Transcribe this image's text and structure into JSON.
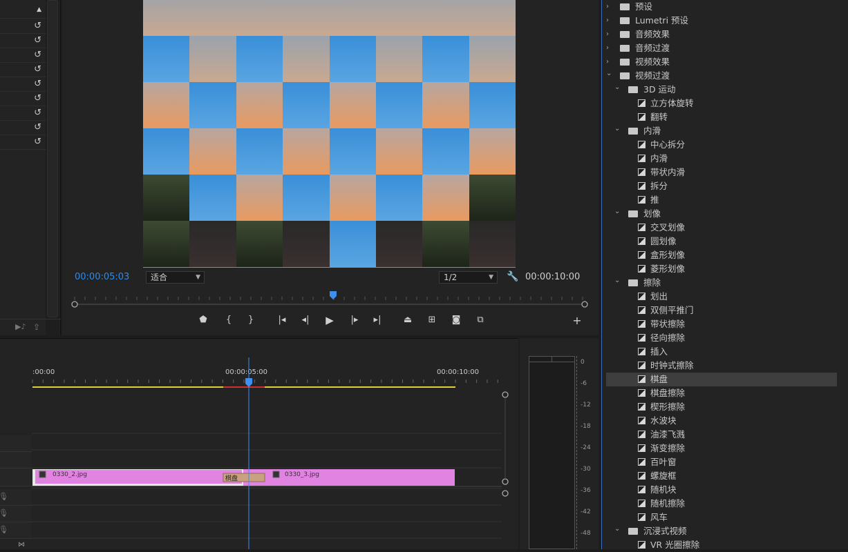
{
  "program": {
    "timecode_current": "00:00:05:03",
    "fit_select": "适合",
    "resolution_select": "1/2",
    "timecode_duration": "00:00:10:00"
  },
  "transport": {
    "marker": "add-marker-icon",
    "in": "mark-in-icon",
    "out": "mark-out-icon",
    "goto_in": "go-to-in-icon",
    "step_back": "step-back-icon",
    "play": "play-icon",
    "step_fwd": "step-forward-icon",
    "goto_out": "go-to-out-icon",
    "lift": "lift-icon",
    "extract": "extract-icon",
    "export_frame": "camera-icon",
    "compare": "comparison-view-icon",
    "add": "add-button-icon"
  },
  "timeline": {
    "ruler_labels": [
      ":00:00",
      "00:00:05:00",
      "00:00:10:00"
    ],
    "clip1": "0330_2.jpg",
    "transition": "棋盘",
    "clip2": "0330_3.jpg"
  },
  "meter": {
    "labels": [
      "0",
      "-6",
      "-12",
      "-18",
      "-24",
      "-30",
      "-36",
      "-42",
      "-48"
    ]
  },
  "effects": {
    "rows": [
      {
        "label": "预设",
        "level": 0,
        "kind": "folder-star",
        "open": false
      },
      {
        "label": "Lumetri 预设",
        "level": 0,
        "kind": "folder-star",
        "open": false
      },
      {
        "label": "音频效果",
        "level": 0,
        "kind": "folder",
        "open": false
      },
      {
        "label": "音频过渡",
        "level": 0,
        "kind": "folder",
        "open": false
      },
      {
        "label": "视频效果",
        "level": 0,
        "kind": "folder",
        "open": false
      },
      {
        "label": "视频过渡",
        "level": 0,
        "kind": "folder",
        "open": true
      },
      {
        "label": "3D 运动",
        "level": 1,
        "kind": "folder",
        "open": true
      },
      {
        "label": "立方体旋转",
        "level": 2,
        "kind": "fx"
      },
      {
        "label": "翻转",
        "level": 2,
        "kind": "fx"
      },
      {
        "label": "内滑",
        "level": 1,
        "kind": "folder",
        "open": true
      },
      {
        "label": "中心拆分",
        "level": 2,
        "kind": "fx"
      },
      {
        "label": "内滑",
        "level": 2,
        "kind": "fx"
      },
      {
        "label": "带状内滑",
        "level": 2,
        "kind": "fx"
      },
      {
        "label": "拆分",
        "level": 2,
        "kind": "fx"
      },
      {
        "label": "推",
        "level": 2,
        "kind": "fx"
      },
      {
        "label": "划像",
        "level": 1,
        "kind": "folder",
        "open": true
      },
      {
        "label": "交叉划像",
        "level": 2,
        "kind": "fx"
      },
      {
        "label": "圆划像",
        "level": 2,
        "kind": "fx"
      },
      {
        "label": "盒形划像",
        "level": 2,
        "kind": "fx"
      },
      {
        "label": "菱形划像",
        "level": 2,
        "kind": "fx"
      },
      {
        "label": "擦除",
        "level": 1,
        "kind": "folder",
        "open": true
      },
      {
        "label": "划出",
        "level": 2,
        "kind": "fx"
      },
      {
        "label": "双侧平推门",
        "level": 2,
        "kind": "fx"
      },
      {
        "label": "带状擦除",
        "level": 2,
        "kind": "fx"
      },
      {
        "label": "径向擦除",
        "level": 2,
        "kind": "fx"
      },
      {
        "label": "插入",
        "level": 2,
        "kind": "fx"
      },
      {
        "label": "时钟式擦除",
        "level": 2,
        "kind": "fx"
      },
      {
        "label": "棋盘",
        "level": 2,
        "kind": "fx",
        "selected": true
      },
      {
        "label": "棋盘擦除",
        "level": 2,
        "kind": "fx"
      },
      {
        "label": "楔形擦除",
        "level": 2,
        "kind": "fx"
      },
      {
        "label": "水波块",
        "level": 2,
        "kind": "fx"
      },
      {
        "label": "油漆飞溅",
        "level": 2,
        "kind": "fx"
      },
      {
        "label": "渐变擦除",
        "level": 2,
        "kind": "fx"
      },
      {
        "label": "百叶窗",
        "level": 2,
        "kind": "fx"
      },
      {
        "label": "螺旋框",
        "level": 2,
        "kind": "fx"
      },
      {
        "label": "随机块",
        "level": 2,
        "kind": "fx"
      },
      {
        "label": "随机擦除",
        "level": 2,
        "kind": "fx"
      },
      {
        "label": "风车",
        "level": 2,
        "kind": "fx"
      },
      {
        "label": "沉浸式视频",
        "level": 1,
        "kind": "folder",
        "open": true
      },
      {
        "label": "VR 光圈擦除",
        "level": 2,
        "kind": "fx"
      }
    ]
  },
  "colors": {
    "accent_blue": "#2d8ceb",
    "clip_pink": "#e183e0",
    "playhead": "#3d8ff0",
    "work_area_yellow": "#e0d23a",
    "render_red": "#d0312d"
  }
}
